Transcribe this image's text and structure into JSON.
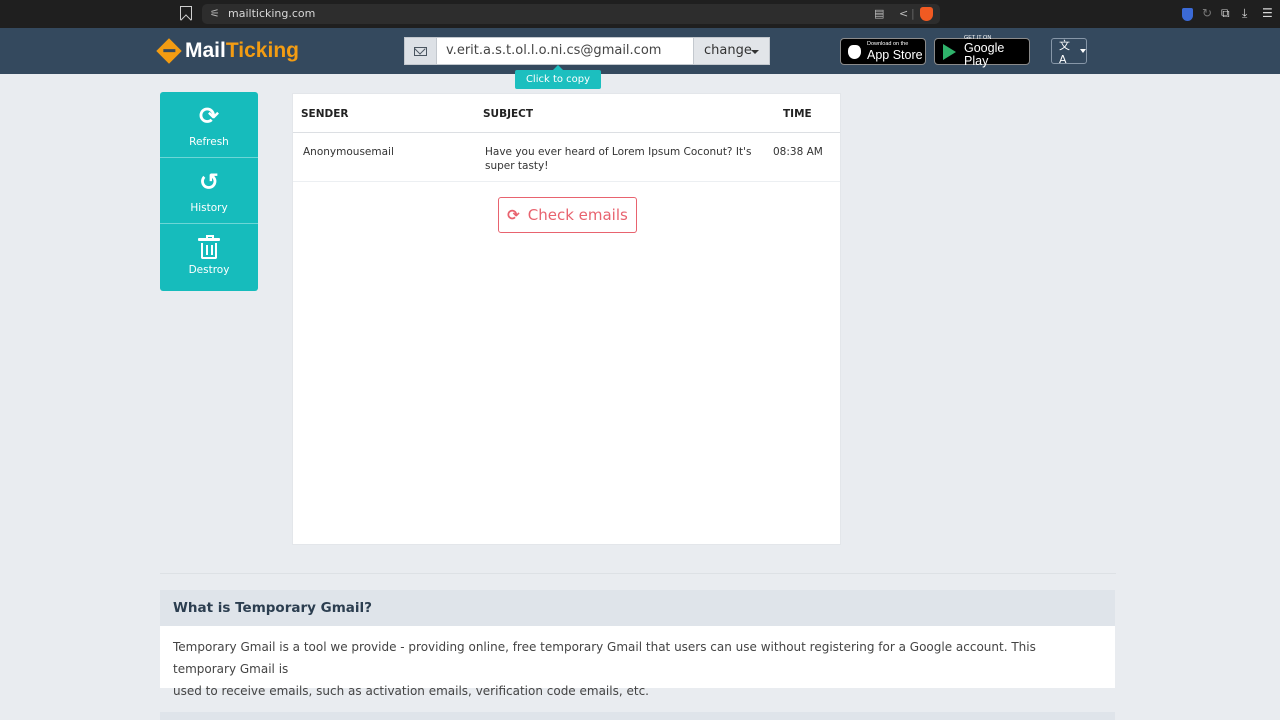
{
  "browser": {
    "url": "mailticking.com",
    "tune_icon": "⚟",
    "reader_icon": "▤",
    "share_icon": "<",
    "ext_icons": [
      "↻",
      "⧉",
      "⤓",
      "☰"
    ]
  },
  "header": {
    "logo_part1": "Mail",
    "logo_part2": "Ticking",
    "email": "v.erit.a.s.t.ol.l.o.ni.cs@gmail.com",
    "change_label": "change",
    "tooltip": "Click to copy",
    "app_store_small": "Download on the",
    "app_store_big": "App Store",
    "google_play_small": "GET IT ON",
    "google_play_big": "Google Play",
    "lang_icon": "文A"
  },
  "sidebar": {
    "items": [
      {
        "label": "Refresh",
        "icon": "⟳"
      },
      {
        "label": "History",
        "icon": "↺"
      },
      {
        "label": "Destroy",
        "icon": "trash-icon"
      }
    ]
  },
  "mail_table": {
    "columns": [
      "SENDER",
      "SUBJECT",
      "TIME"
    ],
    "rows": [
      {
        "sender": "Anonymousemail",
        "subject_line1": "Have you ever heard of Lorem Ipsum Coconut? It's",
        "subject_line2": "super tasty!",
        "time": "08:38 AM"
      }
    ],
    "check_label": "Check emails",
    "check_icon": "⟳"
  },
  "faq": {
    "title": "What is Temporary Gmail?",
    "body_line1": "Temporary Gmail is a tool we provide - providing online, free temporary Gmail that users can use without registering for a Google account. This temporary Gmail is",
    "body_line2": "used to receive emails, such as activation emails, verification code emails, etc."
  },
  "colors": {
    "header_bg": "#34495e",
    "accent_teal": "#16bcbc",
    "logo_orange": "#f39c12",
    "check_red": "#e8636f"
  }
}
